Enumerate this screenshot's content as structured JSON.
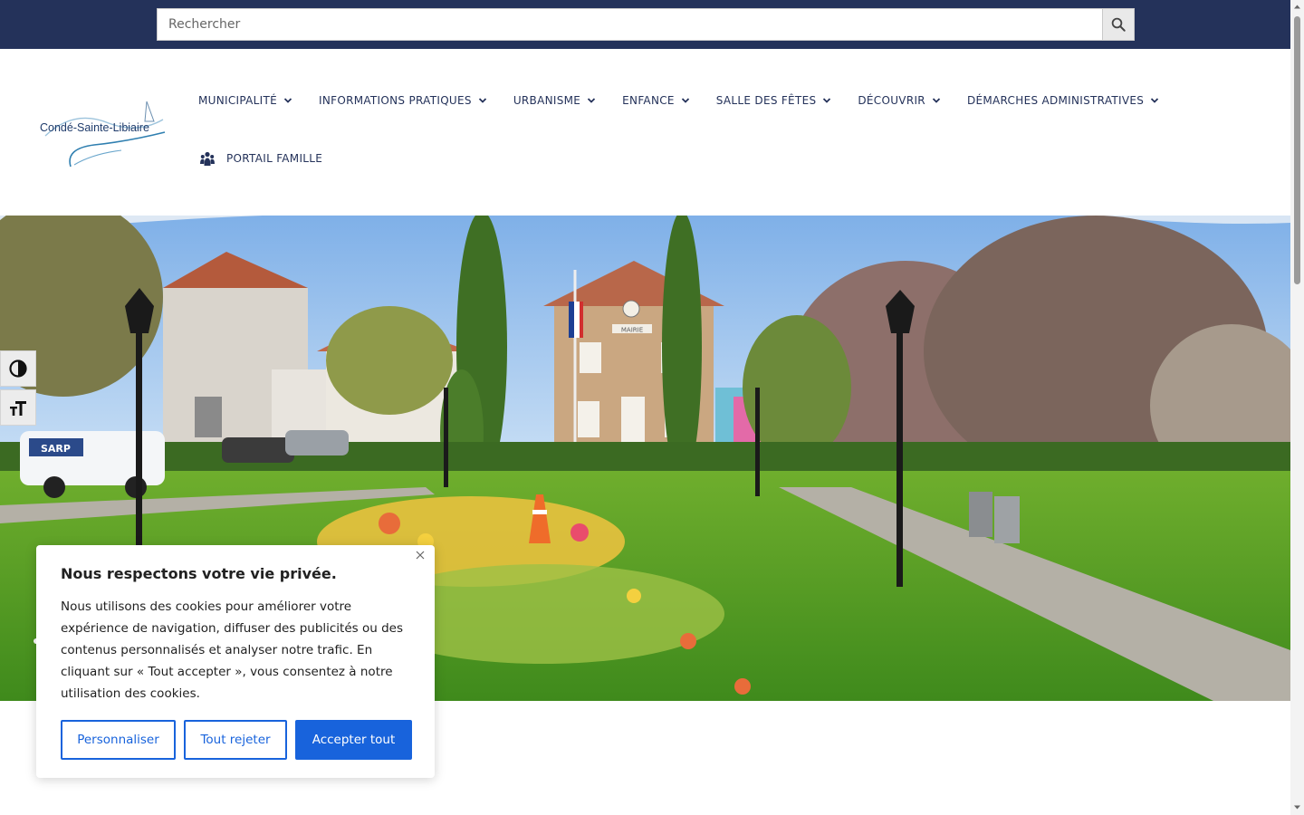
{
  "search": {
    "placeholder": "Rechercher"
  },
  "logo": {
    "text": "Condé-Sainte-Libiaire"
  },
  "nav": {
    "items": [
      {
        "label": "MUNICIPALITÉ"
      },
      {
        "label": "INFORMATIONS PRATIQUES"
      },
      {
        "label": "URBANISME"
      },
      {
        "label": "ENFANCE"
      },
      {
        "label": "SALLE DES FÊTES"
      },
      {
        "label": "DÉCOUVRIR"
      },
      {
        "label": "DÉMARCHES ADMINISTRATIVES"
      }
    ],
    "portail": {
      "label": "PORTAIL FAMILLE",
      "icon": "people-icon"
    }
  },
  "hero": {
    "building_sign": "MAIRIE"
  },
  "vehicle": {
    "text": "SARP"
  },
  "cookie": {
    "title": "Nous respectons votre vie privée.",
    "text": "Nous utilisons des cookies pour améliorer votre expérience de navigation, diffuser des publicités ou des contenus personnalisés et analyser notre trafic. En cliquant sur « Tout accepter », vous consentez à notre utilisation des cookies.",
    "customize": "Personnaliser",
    "reject": "Tout rejeter",
    "accept": "Accepter tout"
  },
  "colors": {
    "topbar": "#24325a",
    "nav_text": "#24325a",
    "cookie_accent": "#1863dc"
  }
}
